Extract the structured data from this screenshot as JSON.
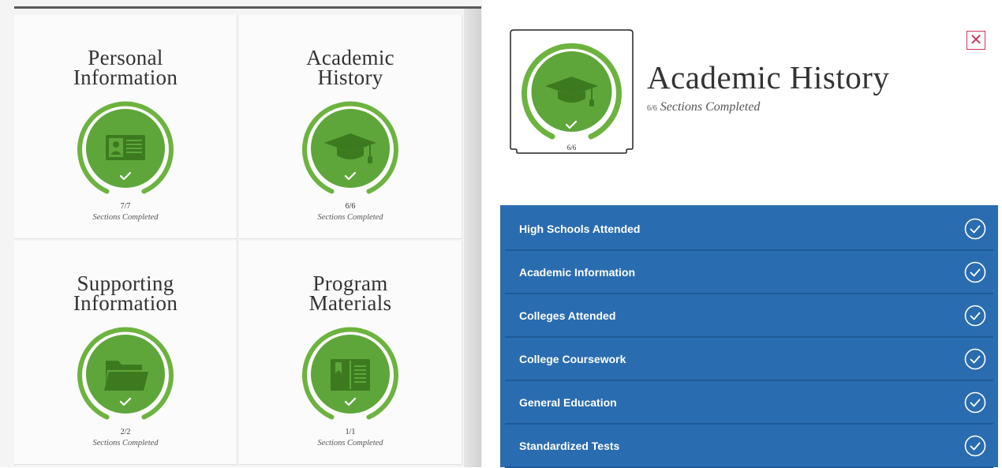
{
  "dashboard": {
    "tiles": [
      {
        "title_line1": "Personal",
        "title_line2": "Information",
        "count": "7/7",
        "status": "Sections Completed",
        "icon": "id-card-icon"
      },
      {
        "title_line1": "Academic",
        "title_line2": "History",
        "count": "6/6",
        "status": "Sections Completed",
        "icon": "graduation-cap-icon"
      },
      {
        "title_line1": "Supporting",
        "title_line2": "Information",
        "count": "2/2",
        "status": "Sections Completed",
        "icon": "folder-icon"
      },
      {
        "title_line1": "Program",
        "title_line2": "Materials",
        "count": "1/1",
        "status": "Sections Completed",
        "icon": "book-icon"
      }
    ]
  },
  "panel": {
    "title": "Academic History",
    "subtitle_fraction": "6/6",
    "subtitle_text": "Sections Completed",
    "badge_count": "6/6",
    "close_symbol": "✕",
    "sections": [
      {
        "label": "High Schools Attended",
        "completed": true
      },
      {
        "label": "Academic Information",
        "completed": true
      },
      {
        "label": "Colleges Attended",
        "completed": true
      },
      {
        "label": "College Coursework",
        "completed": true
      },
      {
        "label": "General Education",
        "completed": true
      },
      {
        "label": "Standardized Tests",
        "completed": true
      }
    ]
  },
  "colors": {
    "ring_green": "#6cb33f",
    "disc_green": "#5ea63a",
    "icon_dark_green": "#3d7a1f",
    "section_blue": "#2a6cb0",
    "close_red": "#c8395a"
  }
}
